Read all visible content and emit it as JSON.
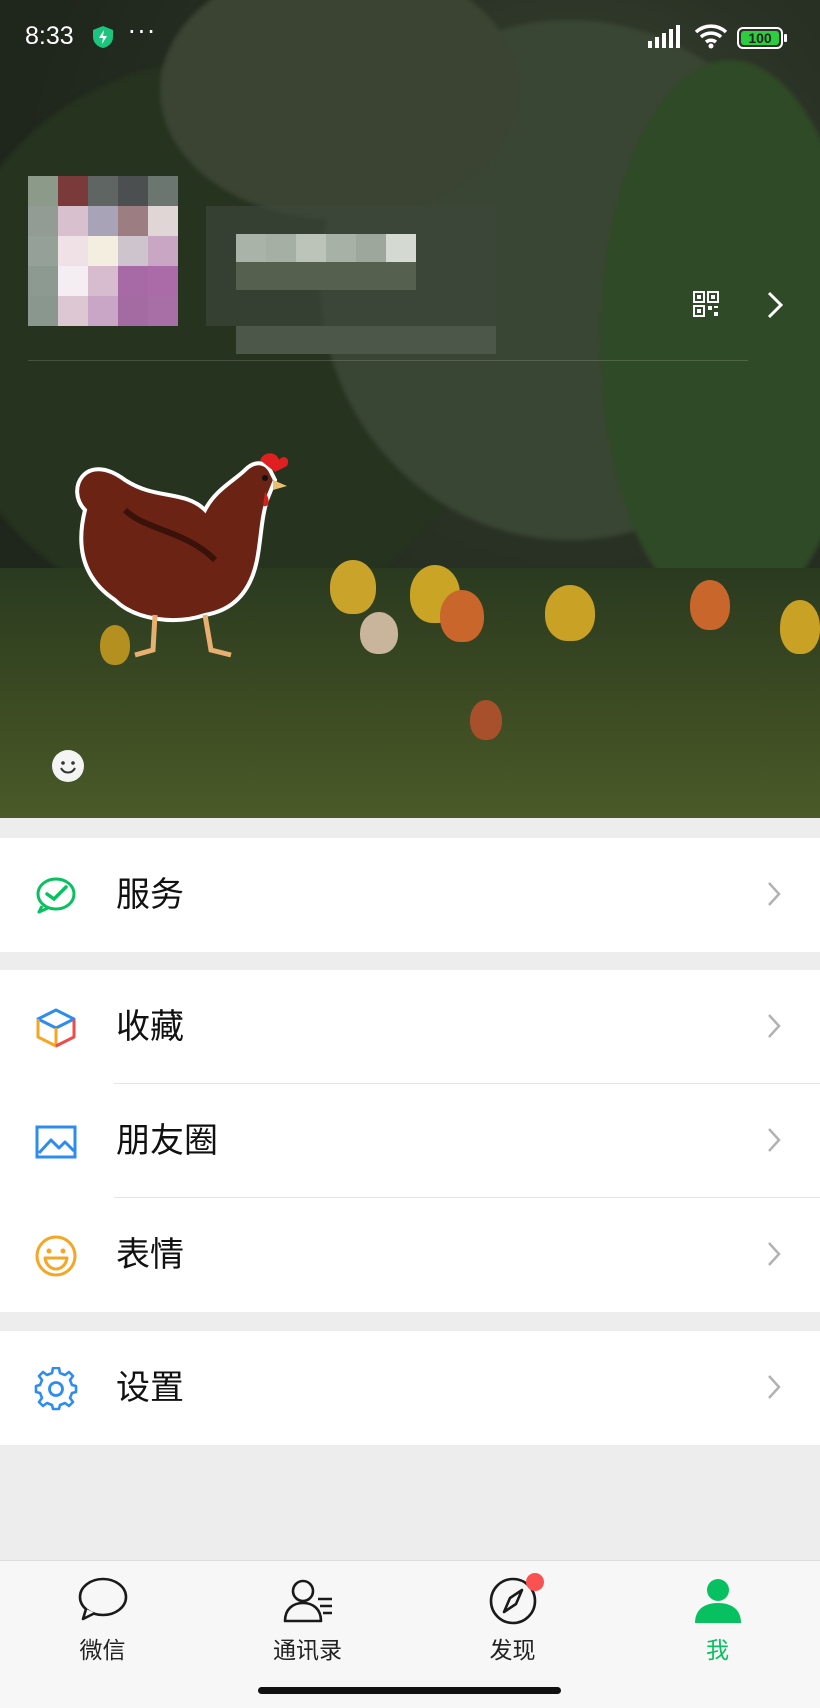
{
  "status_bar": {
    "time": "8:33",
    "dots": "···",
    "battery": "100"
  },
  "colors": {
    "accent": "#07c160",
    "badge": "#fa5151",
    "battery": "#2ecc40"
  },
  "menu": {
    "group1": [
      {
        "label": "服务",
        "icon": "wechat-pay-check-icon"
      }
    ],
    "group2": [
      {
        "label": "收藏",
        "icon": "favorites-cube-icon"
      },
      {
        "label": "朋友圈",
        "icon": "moments-picture-icon"
      },
      {
        "label": "表情",
        "icon": "sticker-smile-icon"
      }
    ],
    "group3": [
      {
        "label": "设置",
        "icon": "settings-gear-icon"
      }
    ]
  },
  "tabbar": {
    "items": [
      {
        "label": "微信",
        "icon": "chat-bubble-icon",
        "active": false
      },
      {
        "label": "通讯录",
        "icon": "contacts-icon",
        "active": false
      },
      {
        "label": "发现",
        "icon": "compass-icon",
        "active": false,
        "badge": true
      },
      {
        "label": "我",
        "icon": "person-icon",
        "active": true
      }
    ]
  }
}
